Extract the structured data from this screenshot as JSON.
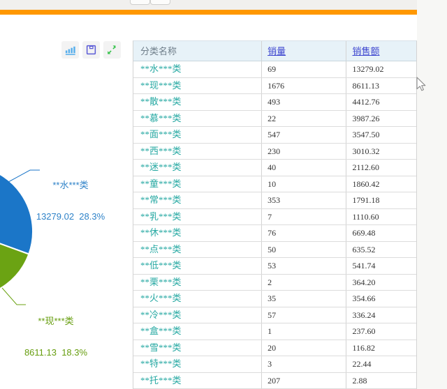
{
  "page": {
    "background": "#ffffff",
    "accent_bar_color": "#ff9800"
  },
  "toolbar": {
    "icons": [
      {
        "name": "bar-chart-icon",
        "color": "#56aeec"
      },
      {
        "name": "save-icon",
        "color": "#5b5bd6"
      },
      {
        "name": "expand-icon",
        "color": "#36c24b"
      }
    ]
  },
  "chart_data": {
    "type": "pie",
    "title": "",
    "value_field": "销售额",
    "legend_position": "none",
    "visible_slices": [
      {
        "label": "**水***类",
        "value": 13279.02,
        "percent": "28.3%",
        "color": "#1b76c8"
      },
      {
        "label": "**现***类",
        "value": 8611.13,
        "percent": "18.3%",
        "color": "#6ba313"
      }
    ],
    "categories": [
      "**水***类",
      "**现***类",
      "**散***类",
      "**慕***类",
      "**面***类",
      "**西***类",
      "**迷***类",
      "**童***类",
      "**常***类",
      "**乳***类",
      "**休***类",
      "**点***类",
      "**低***类",
      "**栗***类",
      "**火***类",
      "**冷***类",
      "**盒***类",
      "**雪***类",
      "**特***类",
      "**托***类"
    ],
    "values": [
      13279.02,
      8611.13,
      4412.76,
      3987.26,
      3547.5,
      3010.32,
      2112.6,
      1860.42,
      1791.18,
      1110.6,
      669.48,
      635.52,
      541.74,
      364.2,
      354.66,
      336.24,
      237.6,
      116.82,
      22.44,
      2.88
    ]
  },
  "pie_labels": {
    "blue": {
      "line1": "**水***类",
      "line2": "13279.02  28.3%"
    },
    "green": {
      "line1": "**现***类",
      "line2": "8611.13  18.3%"
    }
  },
  "table": {
    "headers": [
      "分类名称",
      "销量",
      "销售额"
    ],
    "rows": [
      [
        "**水***类",
        "69",
        "13279.02"
      ],
      [
        "**现***类",
        "1676",
        "8611.13"
      ],
      [
        "**散***类",
        "493",
        "4412.76"
      ],
      [
        "**慕***类",
        "22",
        "3987.26"
      ],
      [
        "**面***类",
        "547",
        "3547.50"
      ],
      [
        "**西***类",
        "230",
        "3010.32"
      ],
      [
        "**迷***类",
        "40",
        "2112.60"
      ],
      [
        "**童***类",
        "10",
        "1860.42"
      ],
      [
        "**常***类",
        "353",
        "1791.18"
      ],
      [
        "**乳***类",
        "7",
        "1110.60"
      ],
      [
        "**休***类",
        "76",
        "669.48"
      ],
      [
        "**点***类",
        "50",
        "635.52"
      ],
      [
        "**低***类",
        "53",
        "541.74"
      ],
      [
        "**栗***类",
        "2",
        "364.20"
      ],
      [
        "**火***类",
        "35",
        "354.66"
      ],
      [
        "**冷***类",
        "57",
        "336.24"
      ],
      [
        "**盒***类",
        "1",
        "237.60"
      ],
      [
        "**雪***类",
        "20",
        "116.82"
      ],
      [
        "**特***类",
        "3",
        "22.44"
      ],
      [
        "**托***类",
        "207",
        "2.88"
      ]
    ]
  }
}
